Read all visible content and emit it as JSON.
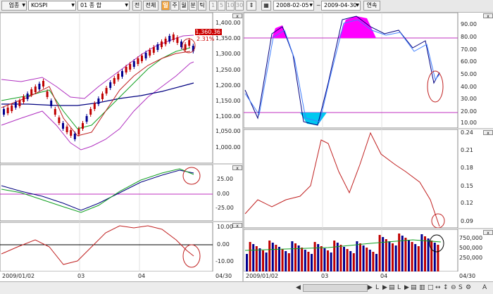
{
  "toolbar": {
    "market_label": "업종",
    "index_label": "KOSPI",
    "code_label": "01 종 합",
    "buttons": [
      "전",
      "전체",
      "일",
      "주",
      "월",
      "분",
      "틱",
      "1",
      "5",
      "10",
      "30"
    ],
    "active_button": "일",
    "start_date": "2008-02-05",
    "end_date": "2009-04-30",
    "tilde": "~",
    "continuous_label": "연속"
  },
  "left_price_axis": [
    "1,400.00",
    "1,350.00",
    "1,300.00",
    "1,250.00",
    "1,200.00",
    "1,150.00",
    "1,100.00",
    "1,050.00",
    "1,000.00"
  ],
  "current_price": "1,360.36",
  "current_change": "2.31%",
  "left_osc1_axis": [
    "25.00",
    "0.00",
    "-25.00"
  ],
  "left_osc2_axis": [
    "10.00",
    "0.00",
    "-10.00"
  ],
  "left_x_labels": [
    "2009/01/02",
    "03",
    "04",
    "04/30"
  ],
  "right_stoch_axis": [
    "90.00",
    "80.00",
    "70.00",
    "60.00",
    "50.00",
    "40.00",
    "30.00",
    "20.00",
    "10.00"
  ],
  "right_vol_axis": [
    "0.24",
    "0.21",
    "0.18",
    "0.15",
    "0.12",
    "0.09"
  ],
  "right_volume_axis": [
    "750,000",
    "500,000",
    "250,000"
  ],
  "right_x_labels": [
    "2009/01/02",
    "03",
    "04",
    "04/30"
  ],
  "panel_button": "x",
  "status_icons": [
    "previous-icon",
    "next-icon",
    "L",
    "▶",
    "table-icon",
    "L",
    "▶",
    "table-icon",
    "chart-icon",
    "square-icon",
    "bar-icon",
    "arrows-icon",
    "expand-icon",
    "S",
    "gear-icon",
    "A"
  ],
  "colors": {
    "up_candle": "#c00000",
    "down_candle": "#000090",
    "bollinger": "#b030c0",
    "ma_long": "#000080",
    "ma_mid": "#10a020",
    "ma_short": "#c02020",
    "stoch_k": "#000080",
    "stoch_d": "#4080ff",
    "overbought_fill": "#ff00ff",
    "oversold_fill": "#00c8f0",
    "osc_line": "#c02020",
    "zero_line": "#c030c0"
  }
}
